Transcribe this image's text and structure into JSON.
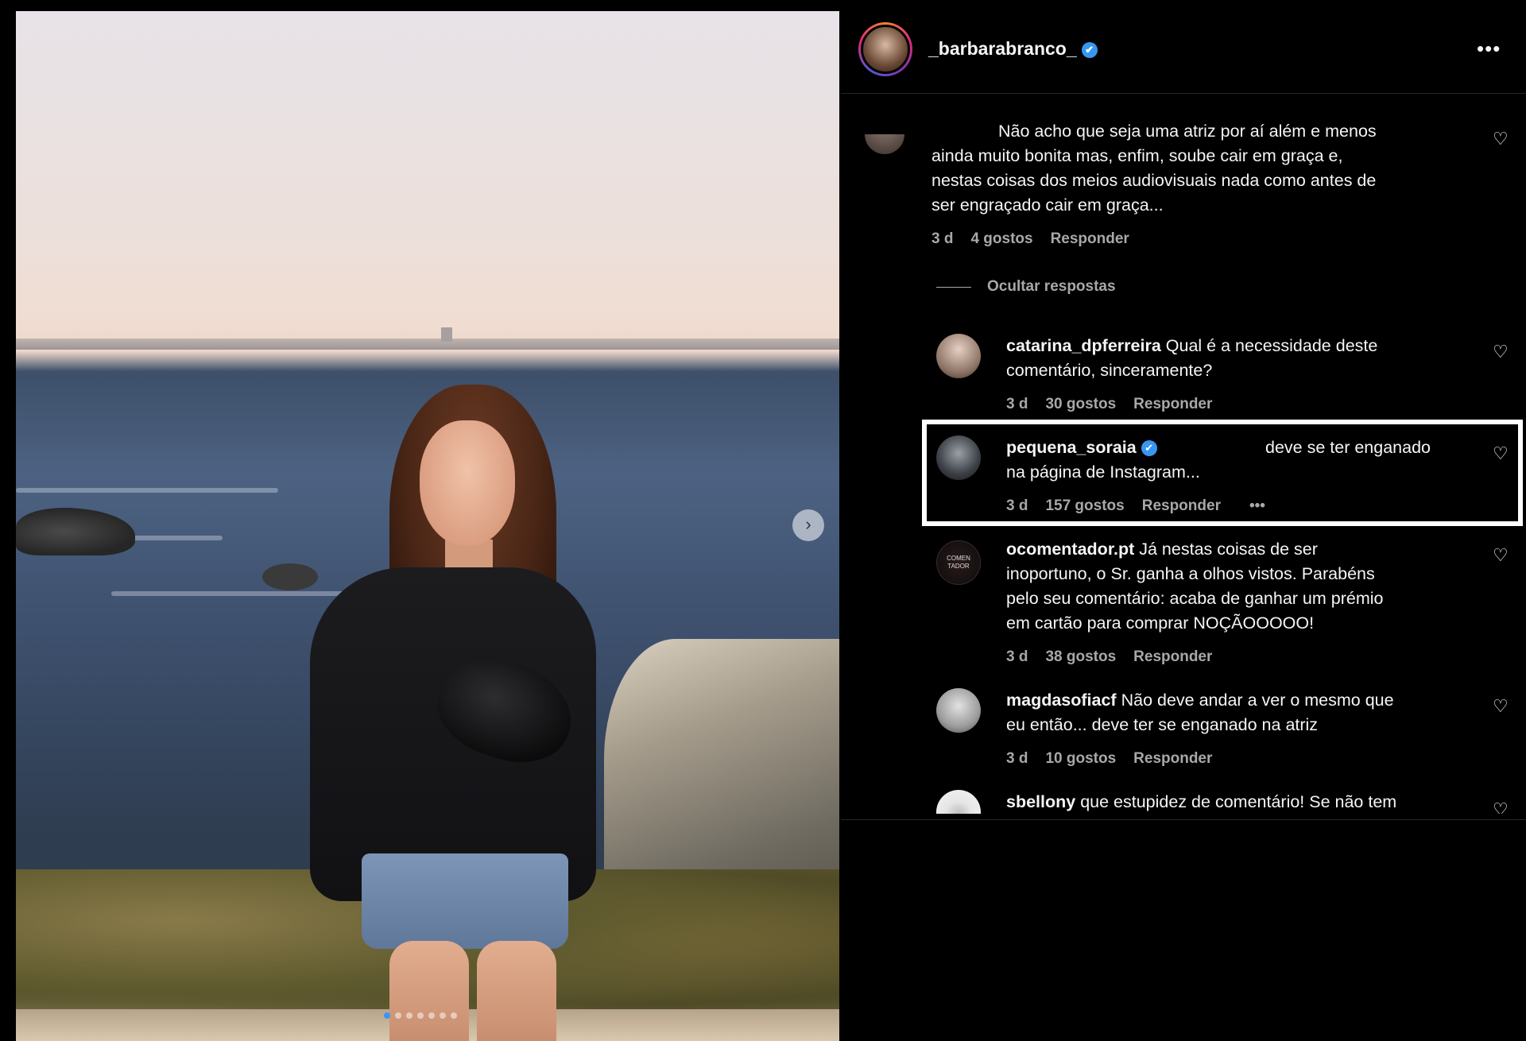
{
  "post": {
    "username": "_barbarabranco_",
    "verified_mark": "✔",
    "more_icon": "more-horizontal-icon",
    "carousel_dots": 7,
    "carousel_active_index": 0
  },
  "comments": [
    {
      "id": "c1",
      "username": "",
      "text": "Não acho que seja uma atriz por aí além e menos ainda muito bonita mas, enfim, soube cair em graça e, nestas coisas dos meios audiovisuais nada como antes de ser engraçado cair em graça...",
      "lines": [
        "Não acho que seja uma atriz por aí além e menos",
        "ainda muito bonita mas, enfim, soube cair em graça e,",
        "nestas coisas dos meios audiovisuais nada como antes de",
        "ser engraçado cair em graça..."
      ],
      "time": "3 d",
      "likes": "4 gostos",
      "reply": "Responder"
    }
  ],
  "hide_replies_label": "Ocultar respostas",
  "replies": [
    {
      "username": "catarina_dpferreira",
      "verified": false,
      "lines": [
        "Qual é a necessidade deste",
        "comentário, sinceramente?"
      ],
      "time": "3 d",
      "likes": "30 gostos",
      "reply": "Responder"
    },
    {
      "username": "pequena_soraia",
      "verified": true,
      "lines": [
        "deve se ter enganado",
        "na página de Instagram..."
      ],
      "time": "3 d",
      "likes": "157 gostos",
      "reply": "Responder",
      "more": "•••",
      "highlighted": true
    },
    {
      "username": "ocomentador.pt",
      "verified": false,
      "lines": [
        "Já nestas coisas de ser",
        "inoportuno, o Sr. ganha a olhos vistos. Parabéns",
        "pelo seu comentário: acaba de ganhar um prémio",
        "em cartão para comprar NOÇÃOOOOO!"
      ],
      "time": "3 d",
      "likes": "38 gostos",
      "reply": "Responder"
    },
    {
      "username": "magdasofiacf",
      "verified": false,
      "lines": [
        "Não deve andar a ver o mesmo que",
        "eu então... deve ter se enganado na atriz"
      ],
      "time": "3 d",
      "likes": "10 gostos",
      "reply": "Responder"
    },
    {
      "username": "sbellony",
      "verified": false,
      "lines": [
        "que estupidez de comentário! Se não tem"
      ],
      "time": "",
      "likes": "",
      "reply": ""
    }
  ],
  "avatar_badge_text": "COMEN TADOR",
  "colors": {
    "background": "#000000",
    "text": "#f5f5f5",
    "meta": "#a8a8a8",
    "verified": "#3797f0",
    "highlight_border": "#ffffff"
  }
}
